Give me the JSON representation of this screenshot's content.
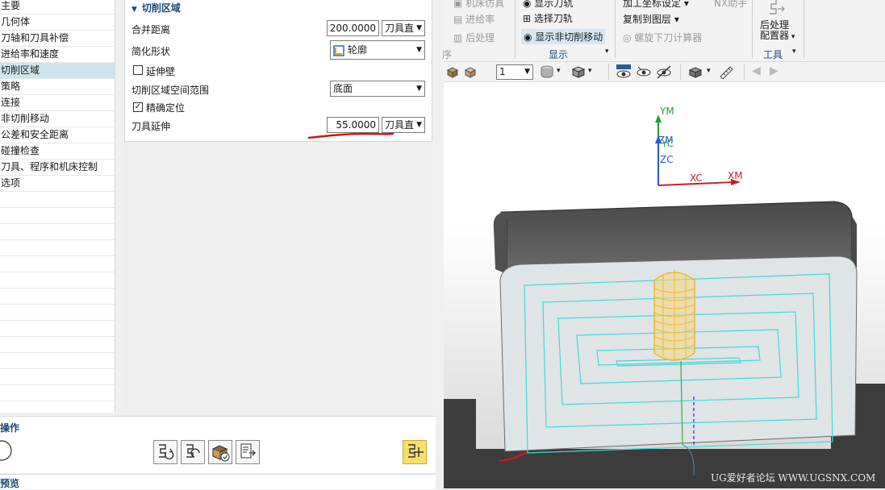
{
  "nav": {
    "items": [
      "主要",
      "几何体",
      "刀轴和刀具补偿",
      "进给率和速度",
      "切削区域",
      "策略",
      "连接",
      "非切削移动",
      "公差和安全距离",
      "碰撞检查",
      "刀具、程序和机床控制",
      "选项"
    ],
    "selected_index": 4
  },
  "panel": {
    "title": "切削区域",
    "merge_distance": {
      "label": "合并距离",
      "value": "200.0000",
      "unit": "刀具直"
    },
    "simplify_shape": {
      "label": "简化形状",
      "value": "轮廓"
    },
    "extend_wall": {
      "label": "延伸壁",
      "checked": false
    },
    "space_range": {
      "label": "切削区域空间范围",
      "value": "底面"
    },
    "precise_position": {
      "label": "精确定位",
      "checked": true
    },
    "tool_extension": {
      "label": "刀具延伸",
      "value": "55.0000",
      "unit": "刀具直"
    }
  },
  "ops": {
    "title": "操作"
  },
  "preview": {
    "title": "预览"
  },
  "ribbon": {
    "machine_sim": "机床仿真",
    "feedrate": "进给率",
    "postprocess_dim": "后处理",
    "show_toolpath": "显示刀轨",
    "select_toolpath": "选择刀轨",
    "show_noncut": "显示非切削移动",
    "group_display": "显示",
    "machine_coord": "加工坐标设定",
    "copy_layer": "复制到图层",
    "spiral_calc": "螺旋下刀计算器",
    "nx_assistant": "NX助手",
    "postprocessor": "后处理\n配置器",
    "post_line1": "后处理",
    "post_line2": "配置器",
    "group_tools": "工具",
    "group_left_tail": "序",
    "layer_value": "1"
  },
  "viewport": {
    "axes": {
      "ym": "YM",
      "yc": "YC",
      "zm": "ZM",
      "zc": "ZC",
      "xc": "XC",
      "xm": "XM"
    },
    "watermark": "UG爱好者论坛 WWW.UGSNX.COM"
  },
  "colors": {
    "accent": "#1a4a7a",
    "selected": "#cde4ef",
    "annotation": "#d0161c",
    "toolpath": "#40d8d8",
    "tool": "#f0b020"
  }
}
